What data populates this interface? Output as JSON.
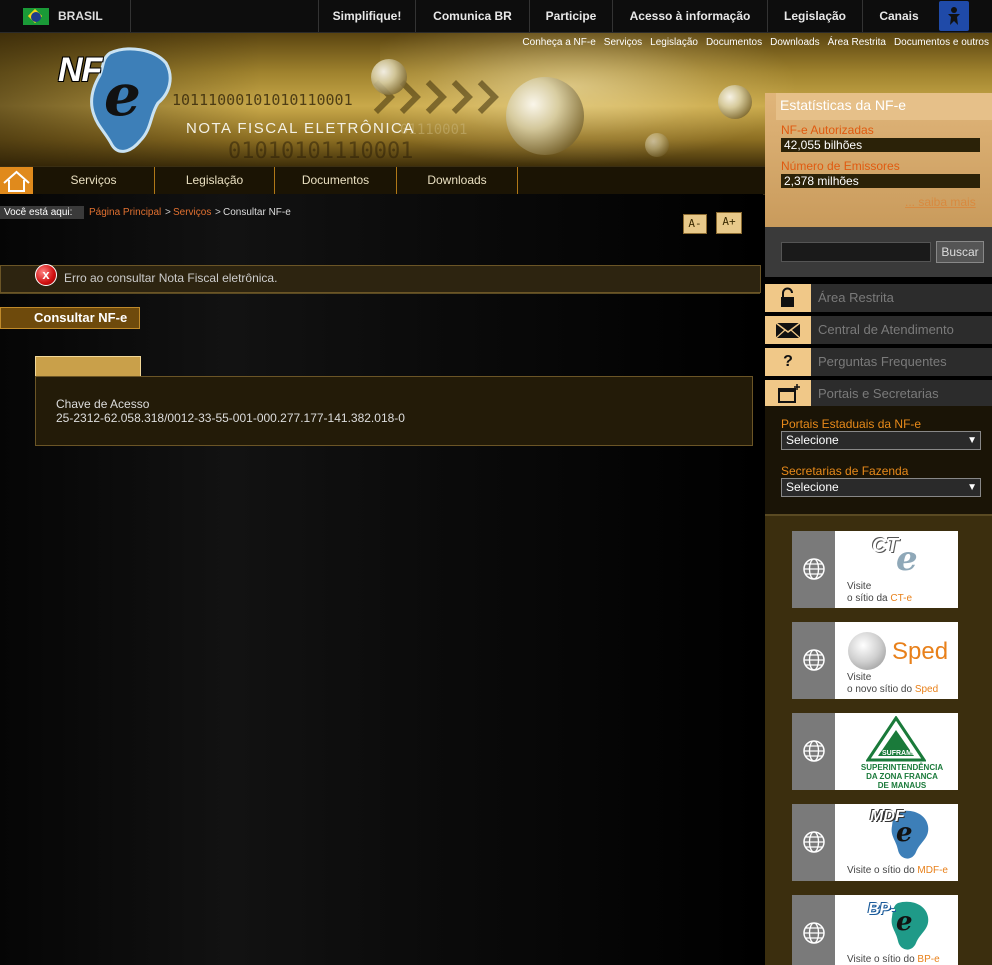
{
  "govbar": {
    "country": "BRASIL",
    "links": [
      "Simplifique!",
      "Comunica BR",
      "Participe",
      "Acesso à informação",
      "Legislação",
      "Canais"
    ]
  },
  "header": {
    "top_links": [
      "Conheça a NF-e",
      "Serviços",
      "Legislação",
      "Documentos",
      "Downloads",
      "Área Restrita",
      "Documentos e outros"
    ],
    "logo_text": "NF",
    "logo_e": "e",
    "subtitle": "NOTA FISCAL ELETRÔNICA",
    "binary_1": "10111000101010110001",
    "binary_2": "01110001",
    "binary_3": "01010101110001"
  },
  "menu": {
    "items": [
      "Serviços",
      "Legislação",
      "Documentos",
      "Downloads"
    ]
  },
  "breadcrumb": {
    "label": "Você está aqui:",
    "items": [
      "Página Principal",
      "Serviços",
      "Consultar NF-e"
    ],
    "sep": ">"
  },
  "font_buttons": {
    "smaller": "A-",
    "larger": "A+"
  },
  "error": {
    "message": "Erro ao consultar Nota Fiscal eletrônica.",
    "icon": "x"
  },
  "page": {
    "title": "Consultar NF-e",
    "field_label": "Chave de Acesso",
    "field_value": "25-2312-62.058.318/0012-33-55-001-000.277.177-141.382.018-0"
  },
  "stats": {
    "title": "Estatísticas da NF-e",
    "authorized_label": "NF-e Autorizadas",
    "authorized_value": "42,055 bilhões",
    "issuers_label": "Número de Emissores",
    "issuers_value": "2,378 milhões",
    "more": "... saiba mais"
  },
  "search": {
    "button": "Buscar",
    "value": ""
  },
  "sidebar": {
    "items": [
      {
        "label": "Área Restrita",
        "icon": "lock-icon"
      },
      {
        "label": "Central de Atendimento",
        "icon": "envelope-icon"
      },
      {
        "label": "Perguntas Frequentes",
        "icon": "question-icon",
        "glyph": "?"
      },
      {
        "label": "Portais e Secretarias",
        "icon": "window-plus-icon"
      }
    ]
  },
  "portals": {
    "state_label": "Portais Estaduais da NF-e",
    "state_value": "Selecione",
    "fazenda_label": "Secretarias de Fazenda",
    "fazenda_value": "Selecione"
  },
  "banners": {
    "cte": {
      "logo": "CT",
      "logo_e": "e",
      "line1": "Visite",
      "line2": "o sítio da",
      "link": "CT-e"
    },
    "sped": {
      "logo": "Sped",
      "line1": "Visite",
      "line2": "o novo sítio do",
      "link": "Sped"
    },
    "suframa": {
      "logo": "SUFRAMA",
      "line1": "SUPERINTENDÊNCIA",
      "line2": "DA ZONA FRANCA",
      "line3": "DE MANAUS"
    },
    "mdfe": {
      "logo": "MDF",
      "logo_e": "e",
      "line1": "Visite o sítio do",
      "link": "MDF-e"
    },
    "bpe": {
      "logo": "BP-",
      "logo_e": "e",
      "line1": "Visite o sítio do",
      "link": "BP-e"
    }
  },
  "colors": {
    "accent": "#e08a1c",
    "error": "#d01010",
    "stats_bg": "#e0b57a"
  }
}
